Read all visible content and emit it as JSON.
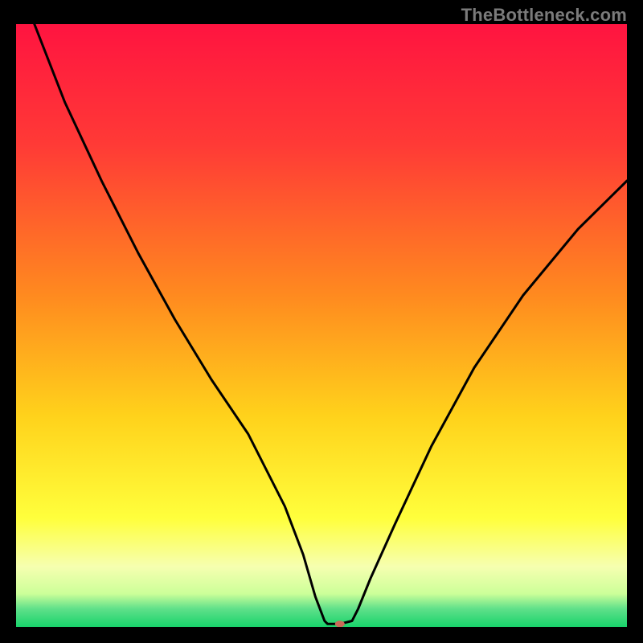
{
  "watermark": "TheBottleneck.com",
  "chart_data": {
    "type": "line",
    "title": "",
    "xlabel": "",
    "ylabel": "",
    "xlim": [
      0,
      100
    ],
    "ylim": [
      0,
      100
    ],
    "background_gradient": {
      "stops": [
        {
          "offset": 0.0,
          "color": "#ff1440"
        },
        {
          "offset": 0.2,
          "color": "#ff3a36"
        },
        {
          "offset": 0.45,
          "color": "#ff8a1f"
        },
        {
          "offset": 0.65,
          "color": "#ffd21b"
        },
        {
          "offset": 0.82,
          "color": "#ffff3c"
        },
        {
          "offset": 0.9,
          "color": "#f6ffb0"
        },
        {
          "offset": 0.945,
          "color": "#ccff99"
        },
        {
          "offset": 0.97,
          "color": "#5fe08a"
        },
        {
          "offset": 1.0,
          "color": "#18d36b"
        }
      ]
    },
    "series": [
      {
        "name": "bottleneck-curve",
        "color": "#000000",
        "x": [
          3,
          8,
          14,
          20,
          26,
          32,
          38,
          44,
          47,
          49,
          50.5,
          51,
          53,
          55,
          56,
          58,
          62,
          68,
          75,
          83,
          92,
          100
        ],
        "y": [
          100,
          87,
          74,
          62,
          51,
          41,
          32,
          20,
          12,
          5,
          1,
          0.5,
          0.5,
          1,
          3,
          8,
          17,
          30,
          43,
          55,
          66,
          74
        ]
      }
    ],
    "marker": {
      "x": 53,
      "y": 0.5,
      "color": "#c96b58",
      "rx": 6,
      "ry": 4
    }
  }
}
